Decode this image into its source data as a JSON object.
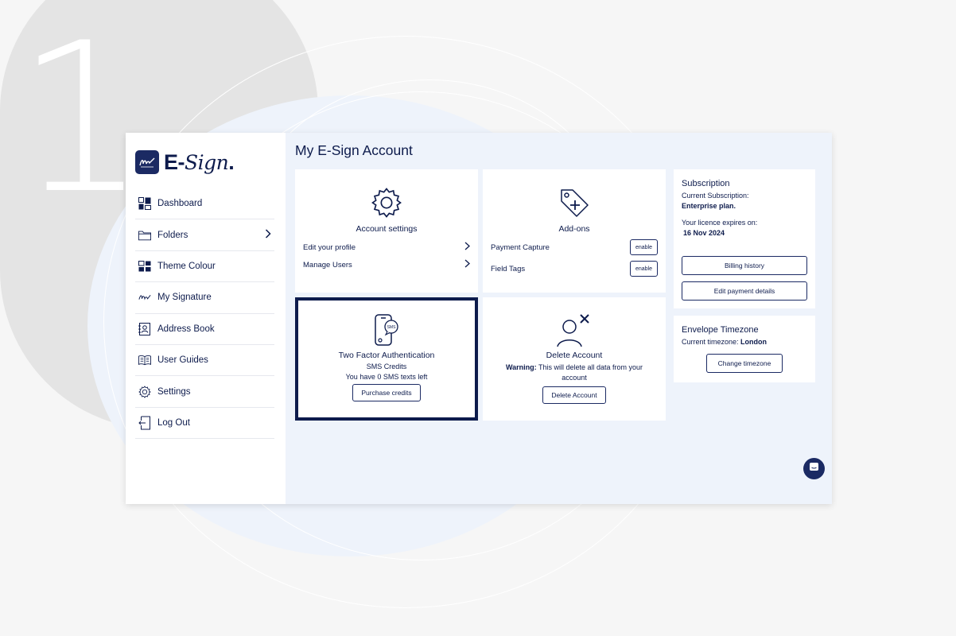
{
  "step_number": "1",
  "logo": {
    "text_bold": "E-",
    "text_script": "Sign",
    "mark": "pen-signature-logo"
  },
  "sidebar": {
    "items": [
      {
        "label": "Dashboard",
        "icon": "dashboard-icon"
      },
      {
        "label": "Folders",
        "icon": "folder-icon",
        "has_chevron": true
      },
      {
        "label": "Theme Colour",
        "icon": "theme-icon"
      },
      {
        "label": "My Signature",
        "icon": "signature-icon"
      },
      {
        "label": "Address Book",
        "icon": "address-book-icon"
      },
      {
        "label": "User Guides",
        "icon": "book-icon"
      },
      {
        "label": "Settings",
        "icon": "gear-icon"
      },
      {
        "label": "Log Out",
        "icon": "logout-icon"
      }
    ]
  },
  "main": {
    "title": "My E-Sign Account",
    "account_settings": {
      "title": "Account settings",
      "links": [
        "Edit your profile",
        "Manage Users"
      ]
    },
    "addons": {
      "title": "Add-ons",
      "items": [
        {
          "label": "Payment Capture",
          "button": "enable"
        },
        {
          "label": "Field Tags",
          "button": "enable"
        }
      ]
    },
    "two_factor": {
      "title": "Two Factor Authentication",
      "subtitle": "SMS Credits",
      "text": "You have 0 SMS texts left",
      "button": "Purchase credits",
      "icon_text": "SMS"
    },
    "delete_account": {
      "title": "Delete Account",
      "warning_label": "Warning:",
      "warning_text": "This will delete all data from your account",
      "button": "Delete Account"
    }
  },
  "subscription": {
    "title": "Subscription",
    "current_label": "Current Subscription:",
    "current_value": "Enterprise plan.",
    "expires_label": "Your licence expires on:",
    "expires_value": "16 Nov 2024",
    "billing_button": "Billing history",
    "payment_button": "Edit payment details"
  },
  "timezone": {
    "title": "Envelope Timezone",
    "current_label": "Current timezone:",
    "current_value": "London",
    "button": "Change timezone"
  },
  "colors": {
    "navy": "#0d1b4c",
    "accent": "#1b2a63",
    "panel_bg": "#eef3fb"
  }
}
